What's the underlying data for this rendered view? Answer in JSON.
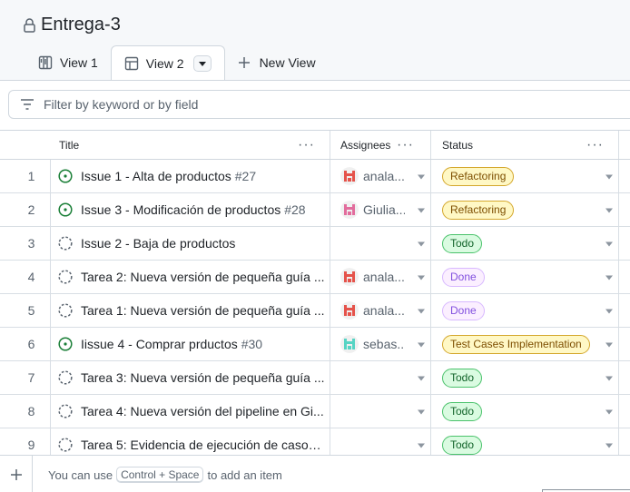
{
  "project": {
    "title": "Entrega-3"
  },
  "tabs": [
    {
      "label": "View 1",
      "icon": "board-icon"
    },
    {
      "label": "View 2",
      "icon": "table-icon",
      "active": true
    }
  ],
  "new_view_label": "New View",
  "filter": {
    "placeholder": "Filter by keyword or by field"
  },
  "columns": {
    "title": "Title",
    "assignees": "Assignees",
    "status": "Status"
  },
  "rows": [
    {
      "num": "1",
      "state": "open",
      "title": "Issue 1 - Alta de productos",
      "issue_no": "#27",
      "assignee": "anala...",
      "avatar_color": "#e5534b",
      "status": "Refactoring",
      "status_style": "yellow"
    },
    {
      "num": "2",
      "state": "open",
      "title": "Issue 3 - Modificación de productos",
      "issue_no": "#28",
      "assignee": "Giulia...",
      "avatar_color": "#e26d9d",
      "status": "Refactoring",
      "status_style": "yellow"
    },
    {
      "num": "3",
      "state": "draft",
      "title": "Issue 2 - Baja de productos",
      "issue_no": "",
      "assignee": "",
      "avatar_color": "",
      "status": "Todo",
      "status_style": "green"
    },
    {
      "num": "4",
      "state": "draft",
      "title": "Tarea 2: Nueva versión de pequeña guía ...",
      "issue_no": "",
      "assignee": "anala...",
      "avatar_color": "#e5534b",
      "status": "Done",
      "status_style": "purple"
    },
    {
      "num": "5",
      "state": "draft",
      "title": "Tarea 1: Nueva versión de pequeña guía ...",
      "issue_no": "",
      "assignee": "anala...",
      "avatar_color": "#e5534b",
      "status": "Done",
      "status_style": "purple"
    },
    {
      "num": "6",
      "state": "open",
      "title": "Iissue 4 - Comprar prductos",
      "issue_no": "#30",
      "assignee": "sebas...",
      "avatar_color": "#56d4c4",
      "status": "Test Cases Implementation",
      "status_style": "yellow"
    },
    {
      "num": "7",
      "state": "draft",
      "title": "Tarea 3: Nueva versión de pequeña guía ...",
      "issue_no": "",
      "assignee": "",
      "avatar_color": "",
      "status": "Todo",
      "status_style": "green"
    },
    {
      "num": "8",
      "state": "draft",
      "title": "Tarea 4: Nueva versión del pipeline en Gi...",
      "issue_no": "",
      "assignee": "",
      "avatar_color": "",
      "status": "Todo",
      "status_style": "green"
    },
    {
      "num": "9",
      "state": "draft",
      "title": "Tarea 5: Evidencia de ejecución de casos ...",
      "issue_no": "",
      "assignee": "",
      "avatar_color": "",
      "status": "Todo",
      "status_style": "green"
    }
  ],
  "footer": {
    "prefix": "You can use",
    "shortcut": "Control + Space",
    "suffix": "to add an item"
  },
  "colors": {
    "open_icon": "#1a7f37",
    "draft_icon": "#59636e",
    "accent_border": "#d0d7de"
  }
}
